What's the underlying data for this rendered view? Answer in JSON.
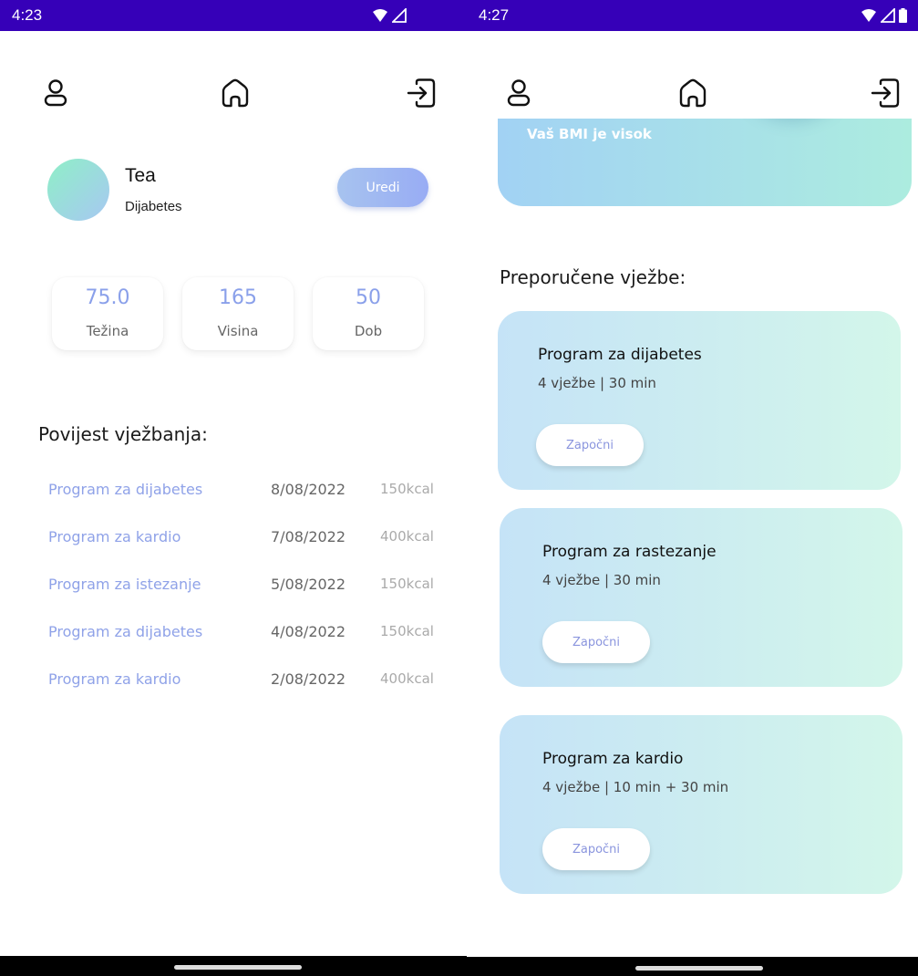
{
  "left_screen": {
    "status_time": "4:23",
    "profile": {
      "name": "Tea",
      "condition": "Dijabetes",
      "edit_label": "Uredi"
    },
    "stats": [
      {
        "value": "75.0",
        "label": "Težina"
      },
      {
        "value": "165",
        "label": "Visina"
      },
      {
        "value": "50",
        "label": "Dob"
      }
    ],
    "history_title": "Povijest vježbanja:",
    "history": [
      {
        "program": "Program za dijabetes",
        "date": "8/08/2022",
        "kcal": "150kcal"
      },
      {
        "program": "Program za kardio",
        "date": "7/08/2022",
        "kcal": "400kcal"
      },
      {
        "program": "Program za istezanje",
        "date": "5/08/2022",
        "kcal": "150kcal"
      },
      {
        "program": "Program za dijabetes",
        "date": "4/08/2022",
        "kcal": "150kcal"
      },
      {
        "program": "Program za kardio",
        "date": "2/08/2022",
        "kcal": "400kcal"
      }
    ]
  },
  "right_screen": {
    "status_time": "4:27",
    "bmi_text": "Vaš BMI je visok",
    "recommended_title": "Preporučene vježbe:",
    "programs": [
      {
        "title": "Program za dijabetes",
        "meta": "4 vježbe | 30 min",
        "start_label": "Započni"
      },
      {
        "title": "Program za rastezanje",
        "meta": "4 vježbe | 30 min",
        "start_label": "Započni"
      },
      {
        "title": "Program za kardio",
        "meta": "4 vježbe | 10 min + 30 min",
        "start_label": "Započni"
      }
    ]
  },
  "icons": {
    "nav": [
      "profile-icon",
      "home-icon",
      "logout-icon"
    ],
    "status": [
      "wifi-icon",
      "signal-icon",
      "battery-icon"
    ]
  },
  "colors": {
    "status_bar": "#3600b8",
    "accent_blue": "#8fa2e8",
    "gradient_start": "#a2d2f4",
    "gradient_end": "#acecdf"
  }
}
